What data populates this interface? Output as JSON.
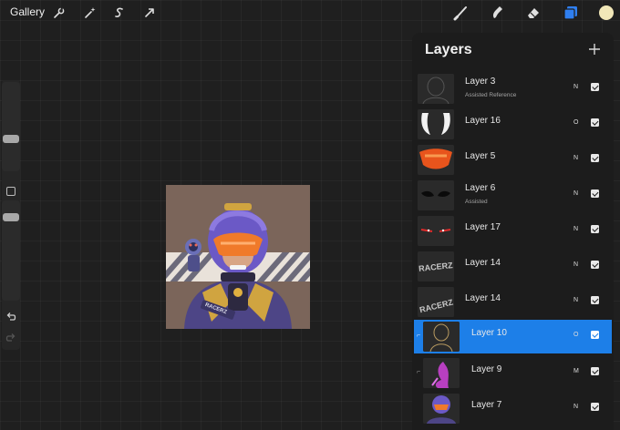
{
  "topbar": {
    "gallery_label": "Gallery",
    "left_tools": [
      "wrench-icon",
      "magic-wand-icon",
      "selection-icon",
      "transform-arrow-icon"
    ],
    "right_tools": [
      "brush-icon",
      "smudge-icon",
      "eraser-icon",
      "layers-icon",
      "color-swatch-icon"
    ],
    "layers_accent": "#2f7ff0",
    "swatch_color": "#f1e7b8"
  },
  "sidebar": {
    "size_slider_level": 0.5,
    "opacity_slider_level": 0.85
  },
  "layers_panel": {
    "title": "Layers",
    "add_icon": "plus-icon",
    "layers": [
      {
        "name": "Layer 3",
        "sub": "Assisted Reference",
        "blend": "N",
        "visible": true
      },
      {
        "name": "Layer 16",
        "sub": "",
        "blend": "O",
        "visible": true
      },
      {
        "name": "Layer 5",
        "sub": "",
        "blend": "N",
        "visible": true
      },
      {
        "name": "Layer 6",
        "sub": "Assisted",
        "blend": "N",
        "visible": true
      },
      {
        "name": "Layer 17",
        "sub": "",
        "blend": "N",
        "visible": true
      },
      {
        "name": "Layer 14",
        "sub": "",
        "blend": "N",
        "visible": true
      },
      {
        "name": "Layer 14",
        "sub": "",
        "blend": "N",
        "visible": true
      },
      {
        "name": "Layer 10",
        "sub": "",
        "blend": "O",
        "visible": true,
        "selected": true
      },
      {
        "name": "Layer 9",
        "sub": "",
        "blend": "M",
        "visible": true
      },
      {
        "name": "Layer 7",
        "sub": "",
        "blend": "N",
        "visible": true
      }
    ]
  },
  "artwork": {
    "badge_text": "RACERZ",
    "thumb_text": "RACERZ"
  }
}
